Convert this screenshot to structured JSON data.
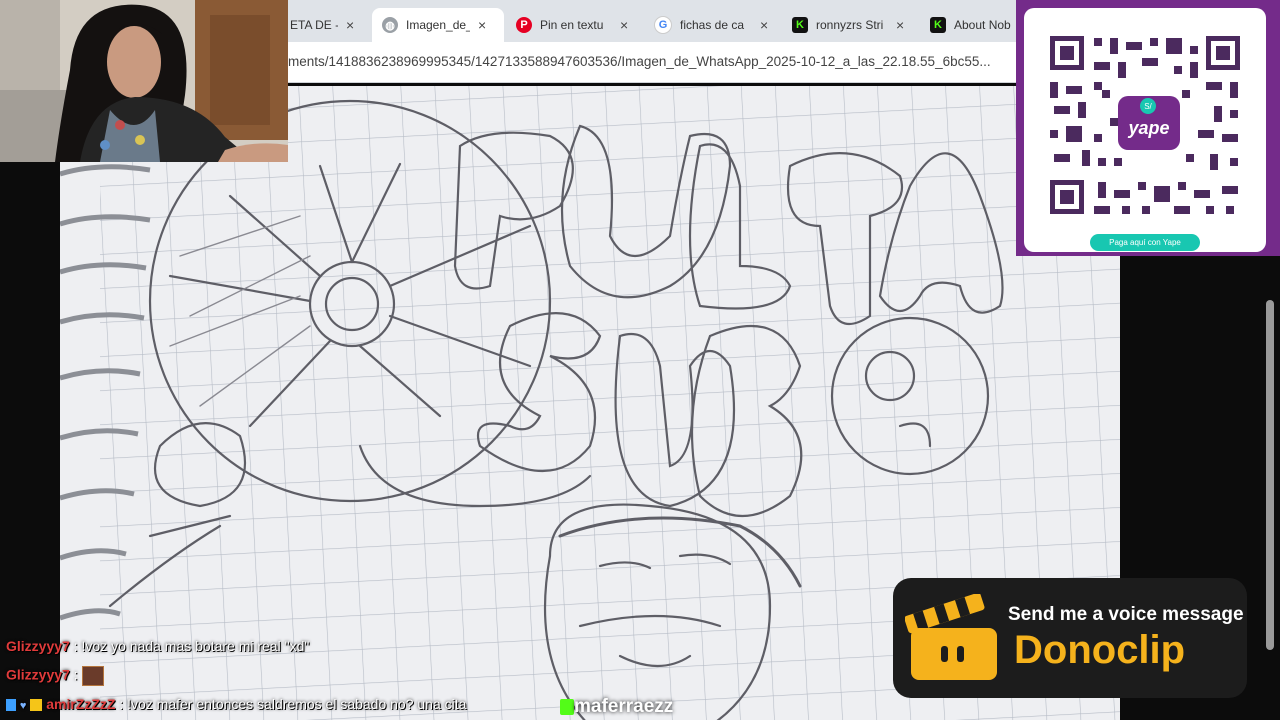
{
  "browser": {
    "tabs": [
      {
        "label": "ETA DE -",
        "favicon": "generic-icon",
        "active": false
      },
      {
        "label": "Imagen_de_",
        "favicon": "globe-icon",
        "active": true
      },
      {
        "label": "Pin en textu",
        "favicon": "pinterest-icon",
        "active": false
      },
      {
        "label": "fichas de ca",
        "favicon": "google-icon",
        "active": false
      },
      {
        "label": "ronnyzrs Stri",
        "favicon": "kick-icon",
        "active": false
      },
      {
        "label": "About Nob",
        "favicon": "kick-icon",
        "active": false
      }
    ],
    "url": "ments/1418836238969995345/1427133588947603536/Imagen_de_WhatsApp_2025-10-12_a_las_22.18.55_6bc55...",
    "close_glyph": "×"
  },
  "qr": {
    "brand": "yape",
    "currency": "S/",
    "caption": "Paga aquí con Yape"
  },
  "donoclip": {
    "tagline": "Send me a voice message",
    "brand": "Donoclip"
  },
  "chat": [
    {
      "user": "Glizzyyy7",
      "sep": ":",
      "message": "!voz yo nada mas botare mi real \"xd\""
    },
    {
      "user": "Glizzyyy7",
      "sep": ":",
      "message": ""
    },
    {
      "user": "amirZzZzZ",
      "sep": ":",
      "message": "!voz mafer entonces saldremos el sabado no? una cita"
    }
  ],
  "streamer": "maferraezz",
  "colors": {
    "purple": "#742b8a",
    "yape_teal": "#18c7b1",
    "donoclip_yellow": "#f5b21c",
    "chat_user": "#e03b3b",
    "kick_green": "#53fc18"
  }
}
